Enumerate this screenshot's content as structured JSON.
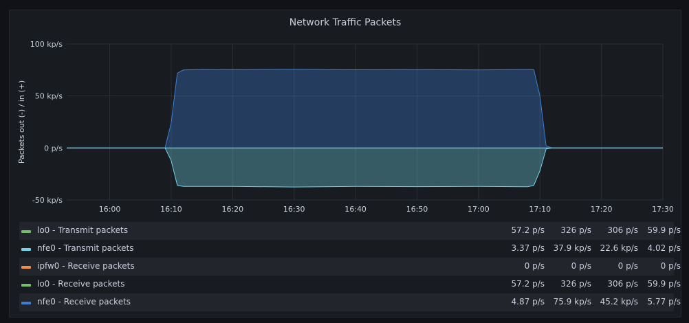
{
  "chart_data": {
    "type": "area",
    "title": "Network Traffic Packets",
    "ylabel": "Packets out (-) / in (+)",
    "ylim": [
      -50,
      100
    ],
    "yticks": [
      {
        "value": 100,
        "label": "100 kp/s"
      },
      {
        "value": 50,
        "label": "50 kp/s"
      },
      {
        "value": 0,
        "label": "0 p/s"
      },
      {
        "value": -50,
        "label": "-50 kp/s"
      }
    ],
    "xticks": [
      "16:00",
      "16:10",
      "16:20",
      "16:30",
      "16:40",
      "16:50",
      "17:00",
      "17:10",
      "17:20",
      "17:30"
    ],
    "series": [
      {
        "name": "lo0 - Transmit packets",
        "color": "#73bf69",
        "stats": [
          "57.2 p/s",
          "326 p/s",
          "306 p/s",
          "59.9 p/s"
        ]
      },
      {
        "name": "nfe0 - Transmit packets",
        "color": "#73d3e6",
        "stats": [
          "3.37 p/s",
          "37.9 kp/s",
          "22.6 kp/s",
          "4.02 p/s"
        ],
        "points": [
          [
            "15:53",
            0
          ],
          [
            "16:09",
            0
          ],
          [
            "16:10",
            -12
          ],
          [
            "16:11",
            -36
          ],
          [
            "16:12",
            -37
          ],
          [
            "16:20",
            -37
          ],
          [
            "16:30",
            -37.5
          ],
          [
            "16:40",
            -37
          ],
          [
            "16:50",
            -37.2
          ],
          [
            "17:00",
            -37
          ],
          [
            "17:08",
            -37.3
          ],
          [
            "17:09",
            -36
          ],
          [
            "17:10",
            -22
          ],
          [
            "17:11",
            -1
          ],
          [
            "17:12",
            0
          ],
          [
            "17:30",
            0
          ]
        ]
      },
      {
        "name": "ipfw0 - Receive packets",
        "color": "#f28e41",
        "stats": [
          "0 p/s",
          "0 p/s",
          "0 p/s",
          "0 p/s"
        ]
      },
      {
        "name": "lo0 - Receive packets",
        "color": "#73bf69",
        "stats": [
          "57.2 p/s",
          "326 p/s",
          "306 p/s",
          "59.9 p/s"
        ]
      },
      {
        "name": "nfe0 - Receive packets",
        "color": "#3d7fd4",
        "stats": [
          "4.87 p/s",
          "75.9 kp/s",
          "45.2 kp/s",
          "5.77 p/s"
        ],
        "points": [
          [
            "15:53",
            0
          ],
          [
            "16:09",
            0
          ],
          [
            "16:10",
            24
          ],
          [
            "16:11",
            72
          ],
          [
            "16:12",
            75
          ],
          [
            "16:15",
            75.5
          ],
          [
            "16:20",
            75.3
          ],
          [
            "16:30",
            75.6
          ],
          [
            "16:40",
            75.2
          ],
          [
            "16:50",
            75.4
          ],
          [
            "17:00",
            75.1
          ],
          [
            "17:07",
            75.5
          ],
          [
            "17:09",
            75.3
          ],
          [
            "17:10",
            50
          ],
          [
            "17:11",
            2
          ],
          [
            "17:12",
            0
          ],
          [
            "17:30",
            0
          ]
        ]
      }
    ]
  }
}
